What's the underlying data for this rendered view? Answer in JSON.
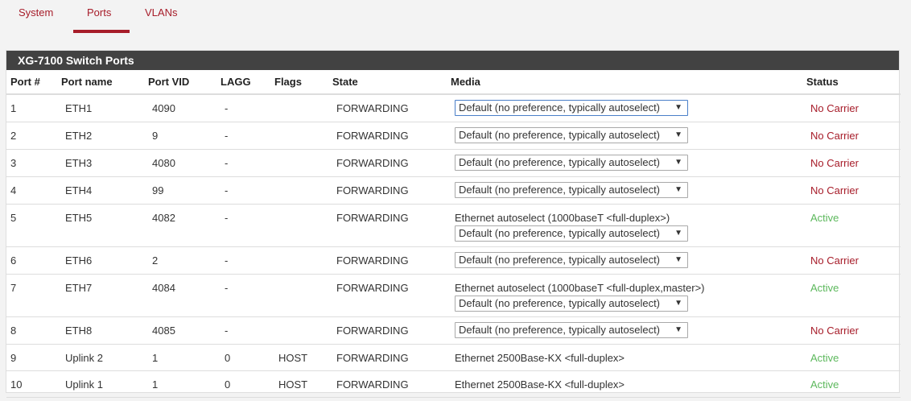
{
  "tabs": [
    {
      "label": "System"
    },
    {
      "label": "Ports"
    },
    {
      "label": "VLANs"
    }
  ],
  "panel": {
    "title": "XG-7100 Switch Ports"
  },
  "columns": [
    "Port #",
    "Port name",
    "Port VID",
    "LAGG",
    "Flags",
    "State",
    "Media",
    "Status"
  ],
  "rows": [
    {
      "port": "1",
      "name": "ETH1",
      "vid": "4090",
      "lagg": "-",
      "flags": "",
      "state": "FORWARDING",
      "media_text": "",
      "select": "Default (no preference, typically autoselect)",
      "status": "No Carrier"
    },
    {
      "port": "2",
      "name": "ETH2",
      "vid": "9",
      "lagg": "-",
      "flags": "",
      "state": "FORWARDING",
      "media_text": "",
      "select": "Default (no preference, typically autoselect)",
      "status": "No Carrier"
    },
    {
      "port": "3",
      "name": "ETH3",
      "vid": "4080",
      "lagg": "-",
      "flags": "",
      "state": "FORWARDING",
      "media_text": "",
      "select": "Default (no preference, typically autoselect)",
      "status": "No Carrier"
    },
    {
      "port": "4",
      "name": "ETH4",
      "vid": "99",
      "lagg": "-",
      "flags": "",
      "state": "FORWARDING",
      "media_text": "",
      "select": "Default (no preference, typically autoselect)",
      "status": "No Carrier"
    },
    {
      "port": "5",
      "name": "ETH5",
      "vid": "4082",
      "lagg": "-",
      "flags": "",
      "state": "FORWARDING",
      "media_text": "Ethernet autoselect (1000baseT <full-duplex>)",
      "select": "Default (no preference, typically autoselect)",
      "status": "Active"
    },
    {
      "port": "6",
      "name": "ETH6",
      "vid": "2",
      "lagg": "-",
      "flags": "",
      "state": "FORWARDING",
      "media_text": "",
      "select": "Default (no preference, typically autoselect)",
      "status": "No Carrier"
    },
    {
      "port": "7",
      "name": "ETH7",
      "vid": "4084",
      "lagg": "-",
      "flags": "",
      "state": "FORWARDING",
      "media_text": "Ethernet autoselect (1000baseT <full-duplex,master>)",
      "select": "Default (no preference, typically autoselect)",
      "status": "Active"
    },
    {
      "port": "8",
      "name": "ETH8",
      "vid": "4085",
      "lagg": "-",
      "flags": "",
      "state": "FORWARDING",
      "media_text": "",
      "select": "Default (no preference, typically autoselect)",
      "status": "No Carrier"
    },
    {
      "port": "9",
      "name": "Uplink 2",
      "vid": "1",
      "lagg": "0",
      "flags": "HOST",
      "state": "FORWARDING",
      "media_text": "Ethernet 2500Base-KX <full-duplex>",
      "select": "",
      "status": "Active"
    },
    {
      "port": "10",
      "name": "Uplink 1",
      "vid": "1",
      "lagg": "0",
      "flags": "HOST",
      "state": "FORWARDING",
      "media_text": "Ethernet 2500Base-KX <full-duplex>",
      "select": "",
      "status": "Active"
    }
  ],
  "colors": {
    "accent": "#a71d2a",
    "active": "#5cb85c",
    "header_bg": "#424242"
  }
}
